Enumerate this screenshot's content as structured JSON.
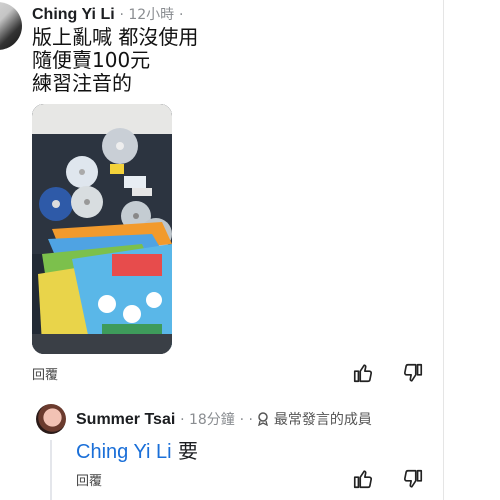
{
  "comment": {
    "author": "Ching Yi Li",
    "time": "12小時",
    "lines": [
      "版上亂喊 都沒使用",
      "隨便賣100元",
      "練習注音的"
    ],
    "reply_label": "回覆"
  },
  "reply": {
    "author": "Summer Tsai",
    "time": "18分鐘",
    "badge": "最常發言的成員",
    "mention": "Ching Yi Li",
    "text": "要",
    "reply_label": "回覆"
  },
  "icons": {
    "like": "thumbs-up-icon",
    "dislike": "thumbs-down-icon",
    "badge": "top-fan-icon"
  },
  "colors": {
    "mention": "#1a6fd8",
    "meta": "#8a8d91"
  }
}
